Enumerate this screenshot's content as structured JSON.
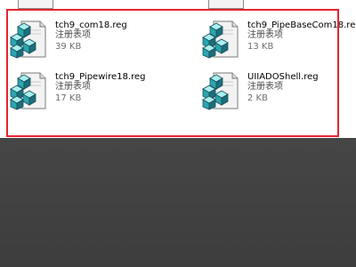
{
  "colors": {
    "highlight_border": "#e8232f",
    "pane_background": "#ffffff",
    "backdrop": "#404040"
  },
  "files": [
    {
      "name": "tch9_com18.reg",
      "type": "注册表项",
      "size": "39 KB",
      "icon": "registry-file-icon"
    },
    {
      "name": "tch9_PipeBaseCom18.reg",
      "type": "注册表项",
      "size": "13 KB",
      "icon": "registry-file-icon"
    },
    {
      "name": "tch9_Pipewire18.reg",
      "type": "注册表项",
      "size": "17 KB",
      "icon": "registry-file-icon"
    },
    {
      "name": "UIIADOShell.reg",
      "type": "注册表项",
      "size": "2 KB",
      "icon": "registry-file-icon"
    }
  ]
}
